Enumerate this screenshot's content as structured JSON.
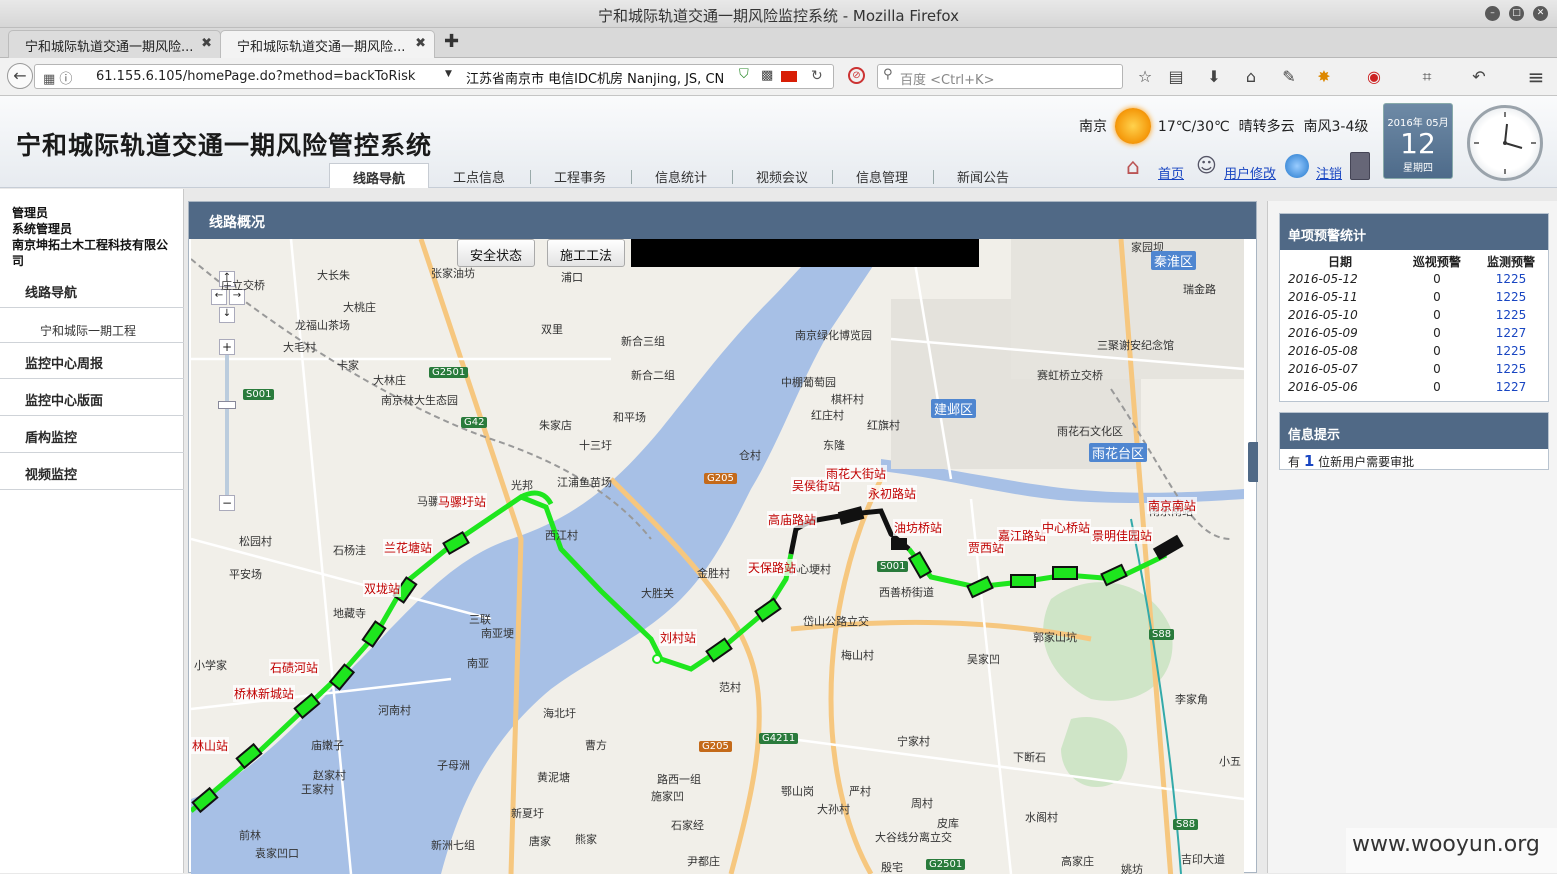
{
  "browser": {
    "window_title": "宁和城际轨道交通一期风险监控系统 - Mozilla Firefox",
    "tabs": [
      {
        "label": "宁和城际轨道交通一期风险..."
      },
      {
        "label": "宁和城际轨道交通一期风险..."
      }
    ],
    "url": "61.155.6.105/homePage.do?method=backToRisk",
    "location_info": "江苏省南京市 电信IDC机房   Nanjing, JS, CN",
    "search_placeholder": "百度 <Ctrl+K>"
  },
  "app": {
    "title": "宁和城际轨道交通一期风险管控系统",
    "menu": [
      "线路导航",
      "工点信息",
      "工程事务",
      "信息统计",
      "视频会议",
      "信息管理",
      "新闻公告"
    ],
    "weather": {
      "city": "南京",
      "temp": "17℃/30℃",
      "desc": "晴转多云",
      "wind": "南风3-4级"
    },
    "links": {
      "home": "首页",
      "user_edit": "用户修改",
      "logout": "注销"
    },
    "calendar": {
      "year_month": "2016年 05月",
      "day": "12",
      "weekday": "星期四"
    }
  },
  "sidebar": {
    "user": [
      "管理员",
      "系统管理员",
      "南京坤拓土木工程科技有限公司"
    ],
    "items": [
      {
        "label": "线路导航"
      },
      {
        "label": "宁和城际一期工程"
      },
      {
        "label": "监控中心周报"
      },
      {
        "label": "监控中心版面"
      },
      {
        "label": "盾构监控"
      },
      {
        "label": "视频监控"
      }
    ]
  },
  "panel": {
    "title": "线路概况",
    "map_buttons": [
      "安全状态",
      "施工工法"
    ],
    "stations": [
      "马骡圩站",
      "兰花塘站",
      "双垅站",
      "石碛河站",
      "桥林新城站",
      "林山站",
      "刘村站",
      "天保路站",
      "高庙路站",
      "吴侯街站",
      "雨花大街站",
      "永初路站",
      "油坊桥站",
      "贾西站",
      "嘉江路站",
      "中心桥站",
      "景明佳园站",
      "南京南站"
    ],
    "places": [
      "庄立交桥",
      "大长朱",
      "张家油坊",
      "浦口",
      "大桃庄",
      "龙福山茶场",
      "大毛村",
      "卡家",
      "大林庄",
      "南京林大生态园",
      "双里",
      "新合三组",
      "新合二组",
      "朱家店",
      "十三圩",
      "和平场",
      "江浦鱼苗场",
      "马骡",
      "光邦",
      "西江村",
      "石杨洼",
      "松园村",
      "平安场",
      "地藏寺",
      "三联",
      "南亚埂",
      "南亚",
      "小学家",
      "河南村",
      "庙嫩子",
      "赵家村",
      "王家村",
      "前林",
      "袁家凹口",
      "子母洲",
      "海北圩",
      "黄泥塘",
      "曹方",
      "路西一组",
      "施家凹",
      "新夏圩",
      "唐家",
      "熊家",
      "新洲七组",
      "石家经",
      "尹都庄",
      "南京绿化博览园",
      "中棚葡萄园",
      "棋杆村",
      "红庄村",
      "红旗村",
      "东隆",
      "仓村",
      "小心埂村",
      "金胜村",
      "大胜关",
      "西善桥街道",
      "岱山公路立交",
      "梅山村",
      "范村",
      "宁家村",
      "鄂山岗",
      "大孙村",
      "严村",
      "周村",
      "皮库",
      "大谷线分离立交",
      "殷宅",
      "下断石",
      "水阁村",
      "高家庄",
      "姚坊",
      "郭家山坑",
      "吴家凹",
      "赛虹桥立交桥",
      "雨花石文化区",
      "南京南站",
      "瑞金路",
      "三聚谢安纪念馆",
      "家园坝",
      "小五",
      "李家角",
      "吉印大道"
    ],
    "districts": [
      "秦淮区",
      "建邺区",
      "雨花台区"
    ],
    "highways": [
      "G2501",
      "G42",
      "S001",
      "G205",
      "S001",
      "G4211",
      "G205",
      "S88",
      "S88",
      "G2501"
    ]
  },
  "right": {
    "warn_title": "单项预警统计",
    "warn_headers": [
      "日期",
      "巡视预警",
      "监测预警"
    ],
    "warn_rows": [
      {
        "date": "2016-05-12",
        "patrol": "0",
        "monitor": "1225"
      },
      {
        "date": "2016-05-11",
        "patrol": "0",
        "monitor": "1225"
      },
      {
        "date": "2016-05-10",
        "patrol": "0",
        "monitor": "1225"
      },
      {
        "date": "2016-05-09",
        "patrol": "0",
        "monitor": "1227"
      },
      {
        "date": "2016-05-08",
        "patrol": "0",
        "monitor": "1225"
      },
      {
        "date": "2016-05-07",
        "patrol": "0",
        "monitor": "1225"
      },
      {
        "date": "2016-05-06",
        "patrol": "0",
        "monitor": "1227"
      }
    ],
    "info_title": "信息提示",
    "info": {
      "pre": "有 ",
      "count": "1",
      "post": " 位新用户需要审批"
    }
  },
  "watermark": "www.wooyun.org"
}
